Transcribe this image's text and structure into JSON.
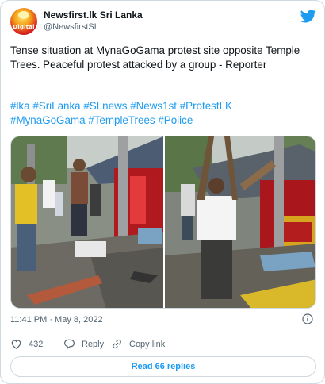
{
  "tweet": {
    "author_name": "Newsfirst.lk Sri Lanka",
    "author_handle": "@NewsfirstSL",
    "avatar_label": "Digital",
    "text": "Tense situation at MynaGoGama protest site opposite Temple Trees. Peaceful protest attacked by a group - Reporter",
    "hashtags_line1": [
      "#lka",
      "#SriLanka",
      "#SLnews",
      "#News1st",
      "#ProtestLK"
    ],
    "hashtags_line2": [
      "#MynaGoGama",
      "#TempleTrees",
      "#Police"
    ],
    "timestamp": "11:41 PM · May 8, 2022"
  },
  "actions": {
    "likes_count": "432",
    "reply_label": "Reply",
    "copy_link_label": "Copy link",
    "read_replies_label": "Read 66 replies"
  },
  "icons": {
    "brand": "twitter-bird-icon",
    "like": "heart-icon",
    "reply": "speech-bubble-icon",
    "copy": "link-icon",
    "info": "info-icon"
  },
  "colors": {
    "accent": "#1d9bf0",
    "text": "#0f1419",
    "muted": "#536471",
    "border": "#cfd9de"
  }
}
